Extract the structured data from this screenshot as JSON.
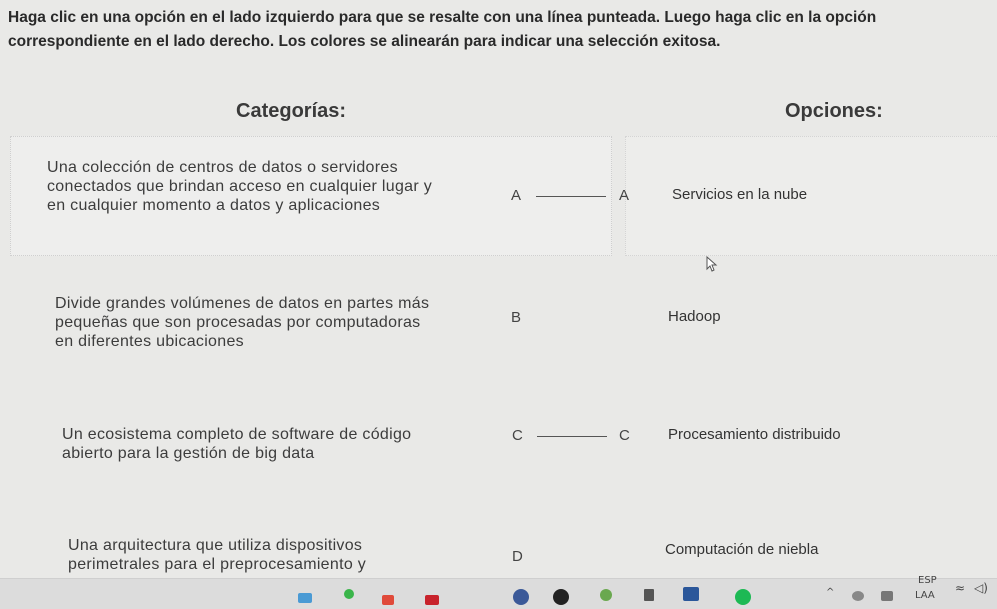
{
  "instructions": "Haga clic en una opción en el lado izquierdo para que se resalte con una línea punteada. Luego haga clic en la opción correspondiente en el lado derecho. Los colores se alinearán para indicar una selección exitosa.",
  "headers": {
    "categories": "Categorías:",
    "options": "Opciones:"
  },
  "categories": [
    {
      "text": "Una colección de centros de datos o servidores conectados que brindan acceso en cualquier lugar y en cualquier momento a datos y aplicaciones",
      "letter": "A"
    },
    {
      "text": "Divide grandes volúmenes de datos en partes más pequeñas que son procesadas por computadoras en diferentes ubicaciones",
      "letter": "B"
    },
    {
      "text": "Un ecosistema completo de software de código abierto para la gestión de big data",
      "letter": "C"
    },
    {
      "text": "Una arquitectura que utiliza dispositivos perimetrales para el preprocesamiento y",
      "letter": "D"
    }
  ],
  "options": [
    {
      "text": "Servicios en la nube",
      "letter": "A"
    },
    {
      "text": "Hadoop",
      "letter": ""
    },
    {
      "text": "Procesamiento distribuido",
      "letter": "C"
    },
    {
      "text": "Computación de niebla",
      "letter": ""
    }
  ],
  "taskbar": {
    "language": "ESP",
    "region": "LAA"
  }
}
